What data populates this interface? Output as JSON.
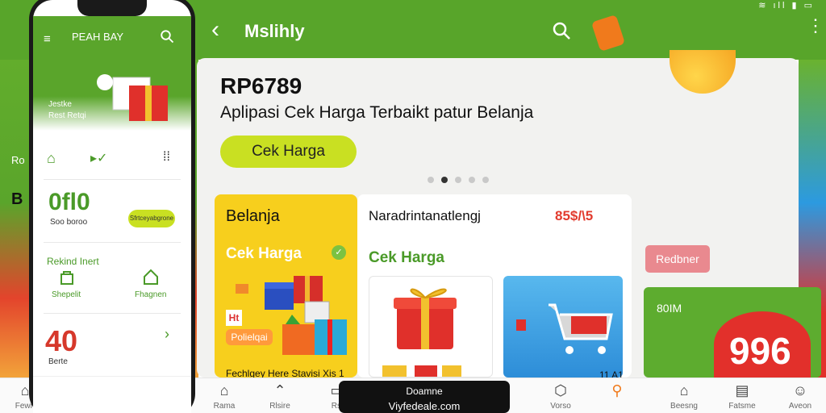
{
  "status_bar": {
    "icons": "≋ ıll ▮ ▭"
  },
  "header": {
    "title": "Mslihly",
    "back_icon": "chevron-left-icon",
    "search_icon": "search-icon",
    "more_icon": "more-vertical-icon"
  },
  "hero": {
    "price": "RP6789",
    "tagline": "Aplipasi Cek Harga Terbaikt patur Belanja",
    "button_label": "Cek Harga",
    "carousel_active_index": 1,
    "carousel_count": 5
  },
  "card_yellow": {
    "title": "Belanja",
    "subtitle": "Cek Harga",
    "badge": "Ht",
    "pill_label": "Polielqai",
    "footer": "Fechlgey Here Stavisi Xis 1"
  },
  "card_white": {
    "title": "Naradrintanatlengj",
    "price": "85$/\\5",
    "subtitle": "Cek Harga",
    "footer": "11 A1"
  },
  "right_column": {
    "pill_label": "Redbner",
    "green_label": "80IM",
    "big_number": "996"
  },
  "bottom_nav": {
    "items": [
      {
        "label": "Fewn",
        "icon": "home-icon"
      },
      {
        "label": "",
        "icon": "chat-icon"
      },
      {
        "label": "",
        "icon": "upload-icon"
      },
      {
        "label": "",
        "icon": "user-icon"
      },
      {
        "label": "Rama",
        "icon": "home-icon"
      },
      {
        "label": "Rlsire",
        "icon": "graduation-icon"
      },
      {
        "label": "Rsi",
        "icon": "cart-icon"
      },
      {
        "label": "Vorso",
        "icon": "package-icon"
      },
      {
        "label": "",
        "icon": "search-icon"
      },
      {
        "label": "Beesng",
        "icon": "home-icon"
      },
      {
        "label": "Fatsme",
        "icon": "book-icon"
      },
      {
        "label": "Aveon",
        "icon": "user-icon"
      }
    ]
  },
  "hud": {
    "top": "Doamne",
    "bottom": "Viyfedeale.com"
  },
  "left_edge": {
    "text": "Ro",
    "letter": "B"
  },
  "phone": {
    "app_title": "PEAH BAY",
    "banner_line1": "Jestke",
    "banner_line2": "Rest Retqi",
    "big_value": "0fl0",
    "big_value_label": "Soo boroo",
    "pill_label": "Sfrtceyabgrone",
    "section_title": "Rekind Inert",
    "icon1_label": "Shepelit",
    "icon2_label": "Fhagnen",
    "count": "40",
    "count_label": "Berte"
  },
  "colors": {
    "brand_green": "#58a52a",
    "accent_lime": "#c9e022",
    "card_yellow": "#f7cf1d",
    "price_red": "#e23b2e"
  }
}
